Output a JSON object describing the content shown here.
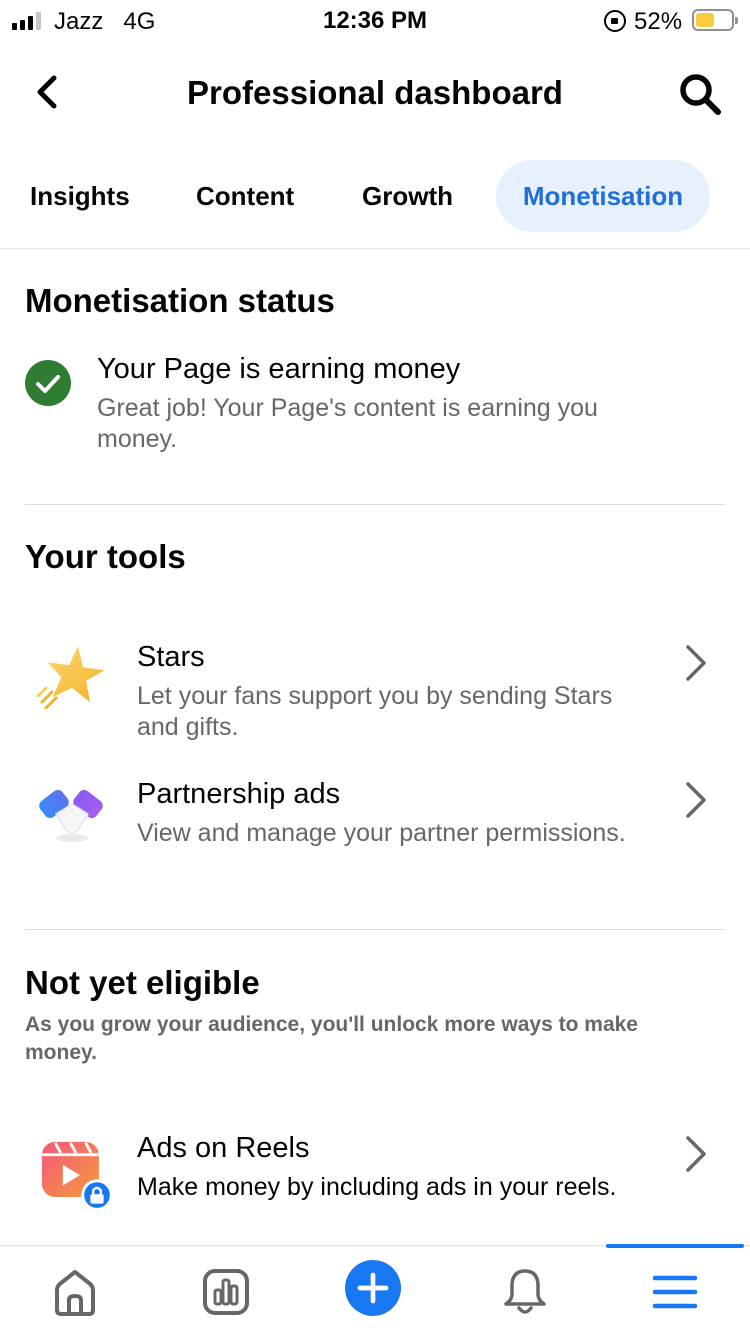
{
  "status_bar": {
    "carrier": "Jazz",
    "network": "4G",
    "time": "12:36 PM",
    "battery_percent": "52%",
    "battery_level": 0.52
  },
  "header": {
    "title": "Professional dashboard"
  },
  "tabs": [
    {
      "label": "Insights",
      "active": false
    },
    {
      "label": "Content",
      "active": false
    },
    {
      "label": "Growth",
      "active": false
    },
    {
      "label": "Monetisation",
      "active": true
    }
  ],
  "monetisation_status": {
    "heading": "Monetisation status",
    "title": "Your Page is earning money",
    "description": "Great job! Your Page's content is earning you money."
  },
  "your_tools": {
    "heading": "Your tools",
    "items": [
      {
        "title": "Stars",
        "description": "Let your fans support you by sending Stars and gifts.",
        "icon": "star-icon"
      },
      {
        "title": "Partnership ads",
        "description": "View and manage your partner permissions.",
        "icon": "handshake-icon"
      }
    ]
  },
  "not_yet_eligible": {
    "heading": "Not yet eligible",
    "subtitle": "As you grow your audience, you'll unlock more ways to make money.",
    "items": [
      {
        "title": "Ads on Reels",
        "description": "Make money by including ads in your reels.",
        "icon": "reels-locked-icon"
      }
    ]
  },
  "bottom_nav": [
    {
      "name": "home",
      "icon": "home-icon"
    },
    {
      "name": "insights",
      "icon": "chart-icon"
    },
    {
      "name": "create",
      "icon": "plus-icon"
    },
    {
      "name": "notifications",
      "icon": "bell-icon"
    },
    {
      "name": "menu",
      "icon": "menu-icon",
      "active": true
    }
  ],
  "colors": {
    "accent": "#1877f2",
    "tab_active_bg": "#e7f0fd",
    "tab_active_text": "#1f6fd6",
    "success": "#2e7d32",
    "secondary_text": "#65676b"
  }
}
